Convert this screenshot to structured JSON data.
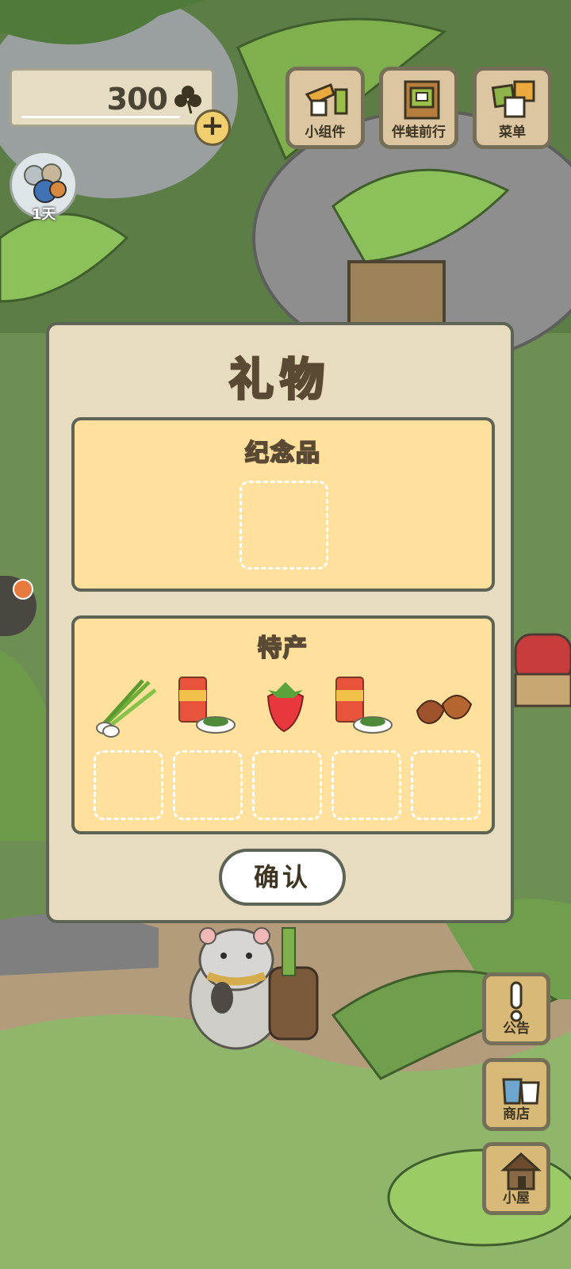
{
  "currency": {
    "amount": "300",
    "icon": "clover-icon"
  },
  "top_buttons": [
    {
      "label": "小组件",
      "icon": "widget-icon"
    },
    {
      "label": "伴蛙前行",
      "icon": "journey-book-icon"
    },
    {
      "label": "菜单",
      "icon": "menu-cards-icon"
    }
  ],
  "avatar": {
    "day_label": "1天"
  },
  "dialog": {
    "title": "礼物",
    "souvenir": {
      "title": "纪念品"
    },
    "specialty": {
      "title": "特产",
      "items": [
        "green-onion-icon",
        "can-with-dish-icon",
        "strawberry-icon",
        "can-with-dish-icon",
        "chestnut-icon"
      ]
    },
    "confirm_label": "确认"
  },
  "side_buttons": [
    {
      "label": "公告",
      "icon": "exclamation-icon"
    },
    {
      "label": "商店",
      "icon": "shop-bags-icon"
    },
    {
      "label": "小屋",
      "icon": "house-icon"
    }
  ],
  "colors": {
    "panel": "#ffe09c",
    "dialog": "#e8dcc0",
    "border": "#5d6456"
  }
}
